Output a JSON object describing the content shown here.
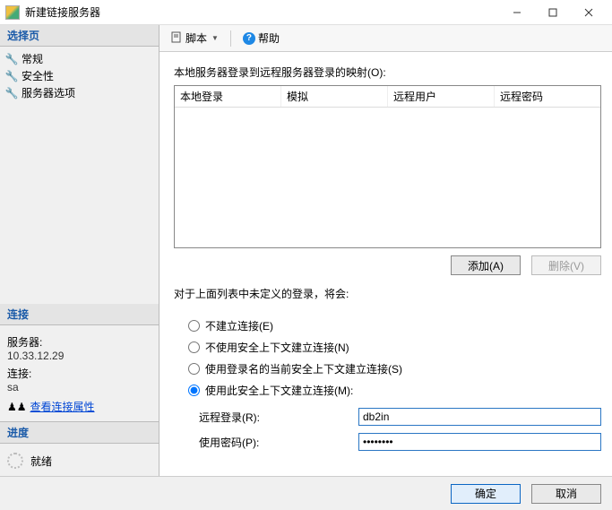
{
  "window": {
    "title": "新建链接服务器"
  },
  "sidebar": {
    "select_page_header": "选择页",
    "items": [
      {
        "label": "常规"
      },
      {
        "label": "安全性"
      },
      {
        "label": "服务器选项"
      }
    ],
    "connection_header": "连接",
    "server_label": "服务器:",
    "server_value": "10.33.12.29",
    "conn_label": "连接:",
    "conn_value": "sa",
    "view_props_label": "查看连接属性",
    "progress_header": "进度",
    "progress_status": "就绪"
  },
  "toolbar": {
    "script_label": "脚本",
    "help_label": "帮助"
  },
  "content": {
    "mapping_label": "本地服务器登录到远程服务器登录的映射(O):",
    "table_headers": [
      "本地登录",
      "模拟",
      "远程用户",
      "远程密码"
    ],
    "add_button": "添加(A)",
    "remove_button": "删除(V)",
    "undefined_logins_label": "对于上面列表中未定义的登录，将会:",
    "radios": {
      "r1": "不建立连接(E)",
      "r2": "不使用安全上下文建立连接(N)",
      "r3": "使用登录名的当前安全上下文建立连接(S)",
      "r4": "使用此安全上下文建立连接(M):"
    },
    "remote_login_label": "远程登录(R):",
    "remote_login_value": "db2in",
    "password_label": "使用密码(P):",
    "password_value": "********"
  },
  "footer": {
    "ok": "确定",
    "cancel": "取消"
  }
}
